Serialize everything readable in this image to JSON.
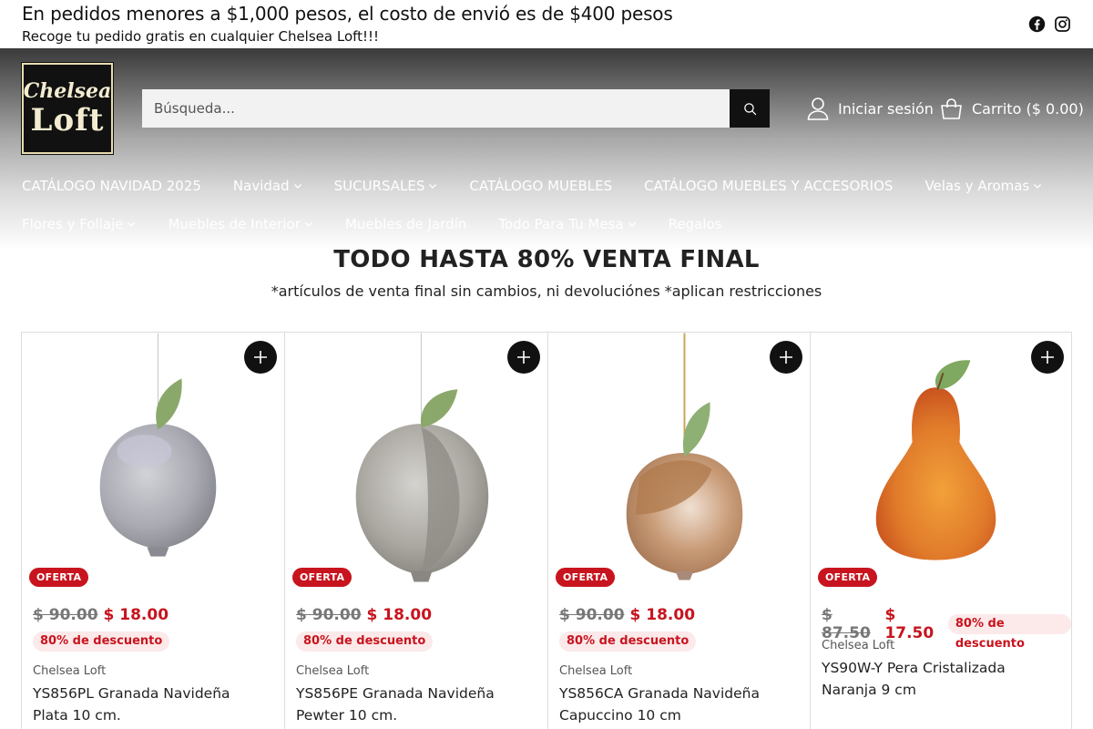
{
  "announcement": {
    "line1": "En pedidos menores a $1,000 pesos, el costo de envió es de $400 pesos",
    "line2": "Recoge tu pedido gratis en cualquier Chelsea Loft!!!"
  },
  "brand": {
    "logo_line1": "Chelsea",
    "logo_line2": "Loft"
  },
  "search": {
    "placeholder": "Búsqueda..."
  },
  "account": {
    "label": "Iniciar sesión"
  },
  "cart": {
    "label": "Carrito ($ 0.00)"
  },
  "nav": {
    "row1": [
      {
        "label": "CATÁLOGO NAVIDAD 2025",
        "dropdown": false
      },
      {
        "label": "Navidad",
        "dropdown": true
      },
      {
        "label": "SUCURSALES",
        "dropdown": true
      },
      {
        "label": "CATÁLOGO MUEBLES",
        "dropdown": false
      },
      {
        "label": "CATÁLOGO MUEBLES Y ACCESORIOS",
        "dropdown": false
      },
      {
        "label": "Velas y Aromas",
        "dropdown": true
      }
    ],
    "row2": [
      {
        "label": "Flores y Follaje",
        "dropdown": true
      },
      {
        "label": "Muebles de Interior",
        "dropdown": true
      },
      {
        "label": "Muebles de Jardín",
        "dropdown": false
      },
      {
        "label": "Todo Para Tu Mesa",
        "dropdown": true
      },
      {
        "label": "Regalos",
        "dropdown": false
      }
    ]
  },
  "page": {
    "title": "TODO HASTA 80% VENTA FINAL",
    "subtitle": "*artículos de venta final sin cambios, ni devoluciónes *aplican restricciones"
  },
  "products": [
    {
      "badge": "OFERTA",
      "old_price": "$ 90.00",
      "new_price": "$ 18.00",
      "discount": "80% de descuento",
      "vendor": "Chelsea Loft",
      "name": "YS856PL Granada Navideña Plata 10 cm.",
      "image": "silver-pomegranate"
    },
    {
      "badge": "OFERTA",
      "old_price": "$ 90.00",
      "new_price": "$ 18.00",
      "discount": "80% de descuento",
      "vendor": "Chelsea Loft",
      "name": "YS856PE Granada Navideña Pewter 10 cm.",
      "image": "pewter-pomegranate"
    },
    {
      "badge": "OFERTA",
      "old_price": "$ 90.00",
      "new_price": "$ 18.00",
      "discount": "80% de descuento",
      "vendor": "Chelsea Loft",
      "name": "YS856CA Granada Navideña Capuccino 10 cm",
      "image": "capuccino-pomegranate"
    },
    {
      "badge": "OFERTA",
      "old_price": "$ 87.50",
      "new_price": "$ 17.50",
      "discount": "80% de descuento",
      "vendor": "Chelsea Loft",
      "name": "YS90W-Y Pera Cristalizada Naranja 9 cm",
      "image": "orange-pear"
    }
  ],
  "colors": {
    "sale_red": "#c8141e",
    "sale_bg": "#fce9ea",
    "dark": "#111111"
  },
  "icons": [
    "facebook-icon",
    "instagram-icon",
    "search-icon",
    "user-icon",
    "cart-icon",
    "chevron-down-icon",
    "plus-icon"
  ]
}
